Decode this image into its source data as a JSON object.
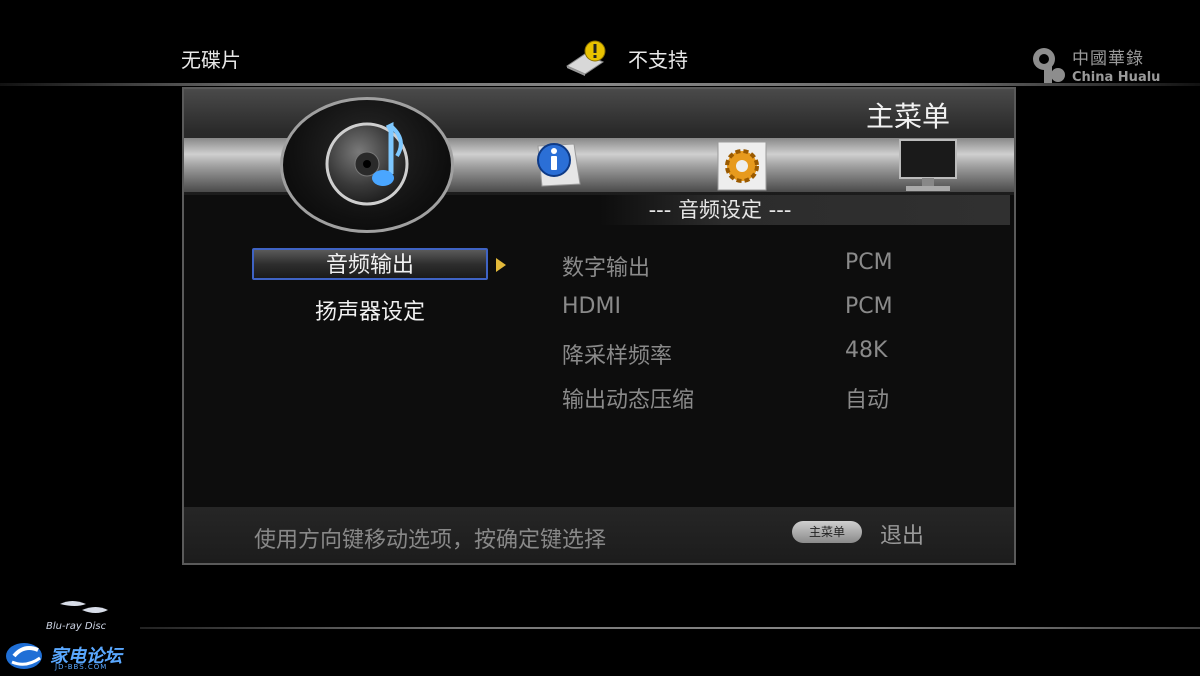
{
  "status_bar": {
    "disc_status": "无碟片",
    "support_status": "不支持",
    "brand_cn": "中國華錄",
    "brand_en": "China Hualu"
  },
  "panel": {
    "title": "主菜单",
    "section_title": "--- 音频设定 ---",
    "header_icons": [
      "music-disc-icon",
      "info-icon",
      "settings-gear-icon",
      "monitor-icon"
    ]
  },
  "menu": {
    "items": [
      {
        "label": "音频输出",
        "selected": true
      },
      {
        "label": "扬声器设定",
        "selected": false
      }
    ]
  },
  "options": [
    {
      "label": "数字输出",
      "value": "PCM"
    },
    {
      "label": "HDMI",
      "value": "PCM"
    },
    {
      "label": "降采样频率",
      "value": "48K"
    },
    {
      "label": "输出动态压缩",
      "value": "自动"
    }
  ],
  "footer": {
    "hint": "使用方向键移动选项，按确定键选择",
    "main_menu_button": "主菜单",
    "exit_label": "退出"
  },
  "logos": {
    "bluray": "Blu-ray Disc",
    "forum": "家电论坛",
    "forum_url": "JD-BBS.COM"
  },
  "colors": {
    "selection_border": "#3f63c4",
    "arrow": "#e3b93a",
    "forum_blue": "#5aa8ff"
  }
}
